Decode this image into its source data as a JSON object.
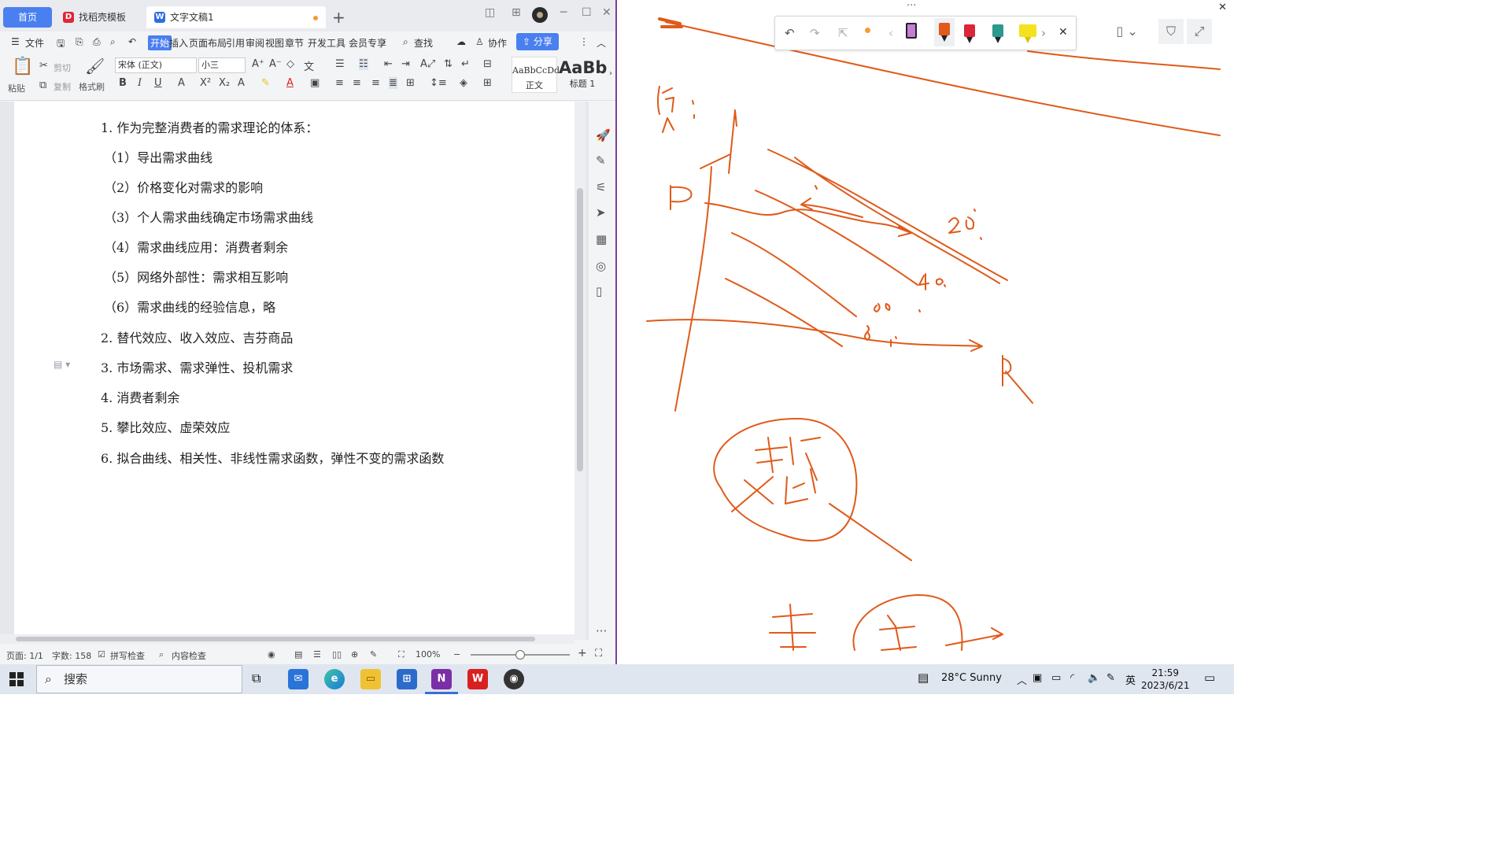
{
  "wps": {
    "tabs": [
      {
        "label": "首页"
      },
      {
        "label": "找稻壳模板"
      },
      {
        "label": "文字文稿1"
      }
    ],
    "menu": [
      "文件",
      "开始",
      "插入",
      "页面布局",
      "引用",
      "审阅",
      "视图",
      "章节",
      "开发工具",
      "会员专享"
    ],
    "search_label": "查找",
    "collab_label": "协作",
    "share_label": "分享",
    "ribbon": {
      "paste": "粘贴",
      "cut": "剪切",
      "copy": "复制",
      "format_painter": "格式刷",
      "font_name": "宋体 (正文)",
      "font_size": "小三",
      "style_normal_preview": "AaBbCcDd",
      "style_normal": "正文",
      "style_h1_preview": "AaBb",
      "style_h1": "标题 1"
    },
    "document": {
      "lines": [
        "1. 作为完整消费者的需求理论的体系：",
        "（1）导出需求曲线",
        "（2）价格变化对需求的影响",
        "（3）个人需求曲线确定市场需求曲线",
        "（4）需求曲线应用：消费者剩余",
        "（5）网络外部性：需求相互影响",
        "（6）需求曲线的经验信息，略",
        "2. 替代效应、收入效应、吉芬商品",
        "3. 市场需求、需求弹性、投机需求",
        "4. 消费者剩余",
        "5. 攀比效应、虚荣效应",
        "6. 拟合曲线、相关性、非线性需求函数，弹性不变的需求函数"
      ]
    },
    "status": {
      "page": "页面: 1/1",
      "words": "字数: 158",
      "spellcheck": "拼写检查",
      "content_check": "内容检查",
      "zoom": "100%",
      "zoom_level": 0.5
    }
  },
  "board": {
    "accent_color": "#e05a1a",
    "more_dots": "···",
    "close": "✕",
    "pens": [
      {
        "color": "#c77dd6",
        "name": "pink-marker-icon"
      },
      {
        "color": "#e05a1a",
        "name": "orange-pen-icon"
      },
      {
        "color": "#d9263a",
        "name": "red-pen-icon"
      },
      {
        "color": "#2a9a8c",
        "name": "teal-pen-icon"
      },
      {
        "color": "#f4e21e",
        "name": "yellow-highlighter-icon"
      }
    ],
    "sketch_labels": [
      "价",
      "P",
      "Q",
      "20",
      "40",
      "60",
      "80"
    ]
  },
  "taskbar": {
    "search": "搜索",
    "weather": "28°C  Sunny",
    "ime": "英",
    "time": "21:59",
    "date": "2023/6/21"
  }
}
